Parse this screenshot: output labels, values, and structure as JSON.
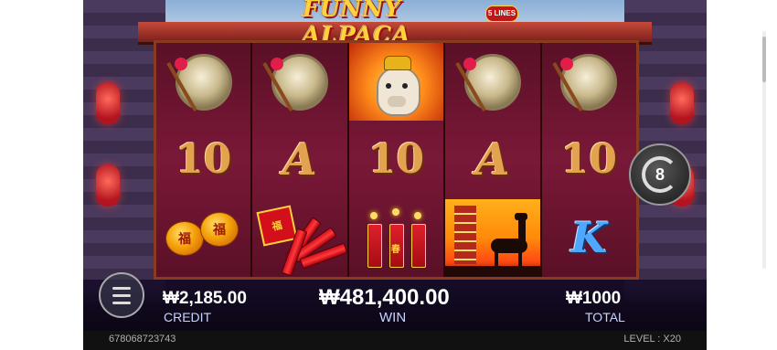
{
  "game": {
    "title": "FUNNY ALPACA",
    "lines_badge": "5 LINES"
  },
  "reels": [
    [
      "gong",
      "10",
      "lanterns"
    ],
    [
      "gong",
      "A",
      "firecrackers"
    ],
    [
      "alpaca",
      "10",
      "firecracker-tubes"
    ],
    [
      "gong",
      "A",
      "pagoda-sunset"
    ],
    [
      "gong",
      "10",
      "K"
    ]
  ],
  "symbol_text": {
    "ten": "10",
    "ace": "A",
    "king": "K",
    "lantern_glyph": "福",
    "firecracker_glyph": "福",
    "tube_glyph": "春"
  },
  "spins_remaining": "8",
  "credit": {
    "value": "₩2,185.00",
    "label": "CREDIT"
  },
  "win": {
    "value": "₩481,400.00",
    "label": "WIN"
  },
  "total": {
    "value": "₩1000",
    "label": "TOTAL"
  },
  "footer": {
    "id": "678068723743",
    "level": "LEVEL : X20"
  },
  "icons": {
    "menu": "hamburger-menu-icon",
    "spin": "auto-spin-icon"
  }
}
